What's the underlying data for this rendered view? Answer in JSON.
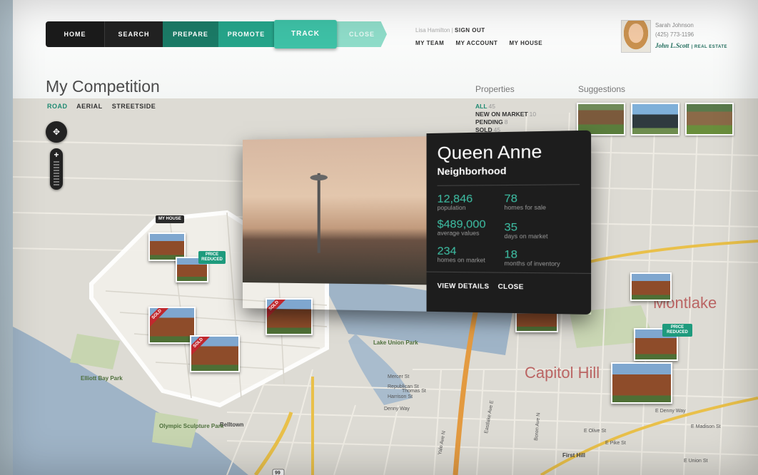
{
  "nav": {
    "steps": [
      "HOME",
      "SEARCH",
      "PREPARE",
      "PROMOTE",
      "TRACK",
      "CLOSE"
    ]
  },
  "account": {
    "user": "Lisa Hamilton",
    "separator": "|",
    "signout": "SIGN OUT",
    "links": [
      "MY TEAM",
      "MY ACCOUNT",
      "MY HOUSE"
    ]
  },
  "agent": {
    "name": "Sarah Johnson",
    "phone": "(425) 773-1196",
    "brand": "John L.Scott",
    "brand_suffix": "| REAL ESTATE"
  },
  "page": {
    "title": "My Competition"
  },
  "map_modes": [
    "ROAD",
    "AERIAL",
    "STREETSIDE"
  ],
  "properties": {
    "heading": "Properties",
    "items": [
      {
        "label": "ALL",
        "count": "45"
      },
      {
        "label": "NEW ON MARKET",
        "count": "10"
      },
      {
        "label": "PENDING",
        "count": "8"
      },
      {
        "label": "SOLD",
        "count": "45"
      }
    ]
  },
  "suggestions": {
    "heading": "Suggestions"
  },
  "map": {
    "pan_glyph": "✥",
    "zoom_plus": "+",
    "tags": {
      "my_house": "MY HOUSE",
      "price_reduced": "PRICE REDUCED",
      "sold": "SOLD"
    },
    "neighborhood_labels": [
      "Montlake",
      "Capitol Hill"
    ],
    "area_labels": [
      "Belltown",
      "First Hill",
      "Olympic Sculpture Park",
      "Elliott Bay Park",
      "Denny Way",
      "E Olive St",
      "E Pike St",
      "E Madison St",
      "E Union St",
      "Mercer St",
      "Republican St",
      "Harrison St",
      "Thomas St",
      "E Denny Way",
      "Eastlake Ave E",
      "Lake Union Park",
      "Yale Ave N",
      "Boren Ave N"
    ],
    "route_badge": "99"
  },
  "popup": {
    "title": "Queen Anne",
    "subtitle": "Neighborhood",
    "stats": [
      {
        "value": "12,846",
        "label": "population"
      },
      {
        "value": "78",
        "label": "homes for sale"
      },
      {
        "value": "$489,000",
        "label": "average values"
      },
      {
        "value": "35",
        "label": "days on market"
      },
      {
        "value": "234",
        "label": "homes on market"
      },
      {
        "value": "18",
        "label": "months of inventory"
      }
    ],
    "view_details": "VIEW DETAILS",
    "close": "CLOSE"
  },
  "colors": {
    "accent": "#3ec1a6",
    "accent_dark": "#1b7a66",
    "sold_red": "#c0282e",
    "neighborhood_label": "#b45050"
  }
}
